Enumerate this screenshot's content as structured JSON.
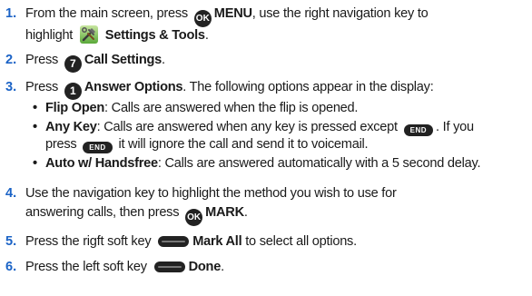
{
  "steps": [
    {
      "num": "1.",
      "t1": "From the main screen, press",
      "k1": "OK",
      "b1": "MENU",
      "t2": ", use the right navigation key to",
      "t3": "highlight",
      "icon": "settings-tools-icon",
      "b2": "Settings & Tools",
      "t4": "."
    },
    {
      "num": "2.",
      "t1": "Press",
      "k1": "7",
      "b1": "Call Settings",
      "t2": "."
    },
    {
      "num": "3.",
      "t1": "Press",
      "k1": "1",
      "b1": "Answer Options",
      "t2": ". The following options appear in the display:",
      "options": [
        {
          "bullet": "•",
          "name": "Flip Open",
          "desc": ": Calls are answered when the flip is opened."
        },
        {
          "bullet": "•",
          "name": "Any Key",
          "desc1": ": Calls are answered when any key is pressed except",
          "endkey": "END",
          "desc2": ". If you",
          "desc3": "press",
          "desc4": "it will ignore the call and send it to voicemail."
        },
        {
          "bullet": "•",
          "name": "Auto w/ Handsfree",
          "desc": ": Calls are answered automatically with a 5 second delay."
        }
      ]
    },
    {
      "num": "4.",
      "line1": "Use the navigation key to highlight the method you wish to use for",
      "line2a": "answering calls, then press",
      "k1": "OK",
      "b1": "MARK",
      "t2": "."
    },
    {
      "num": "5.",
      "t1": "Press the rigft soft key",
      "b1": "Mark All",
      "t2": "to select all options."
    },
    {
      "num": "6.",
      "t1": "Press the left soft key",
      "b1": "Done",
      "t2": "."
    }
  ],
  "colors": {
    "step_number": "#1b63c6",
    "key": "#222222",
    "text": "#1a1a1a"
  }
}
